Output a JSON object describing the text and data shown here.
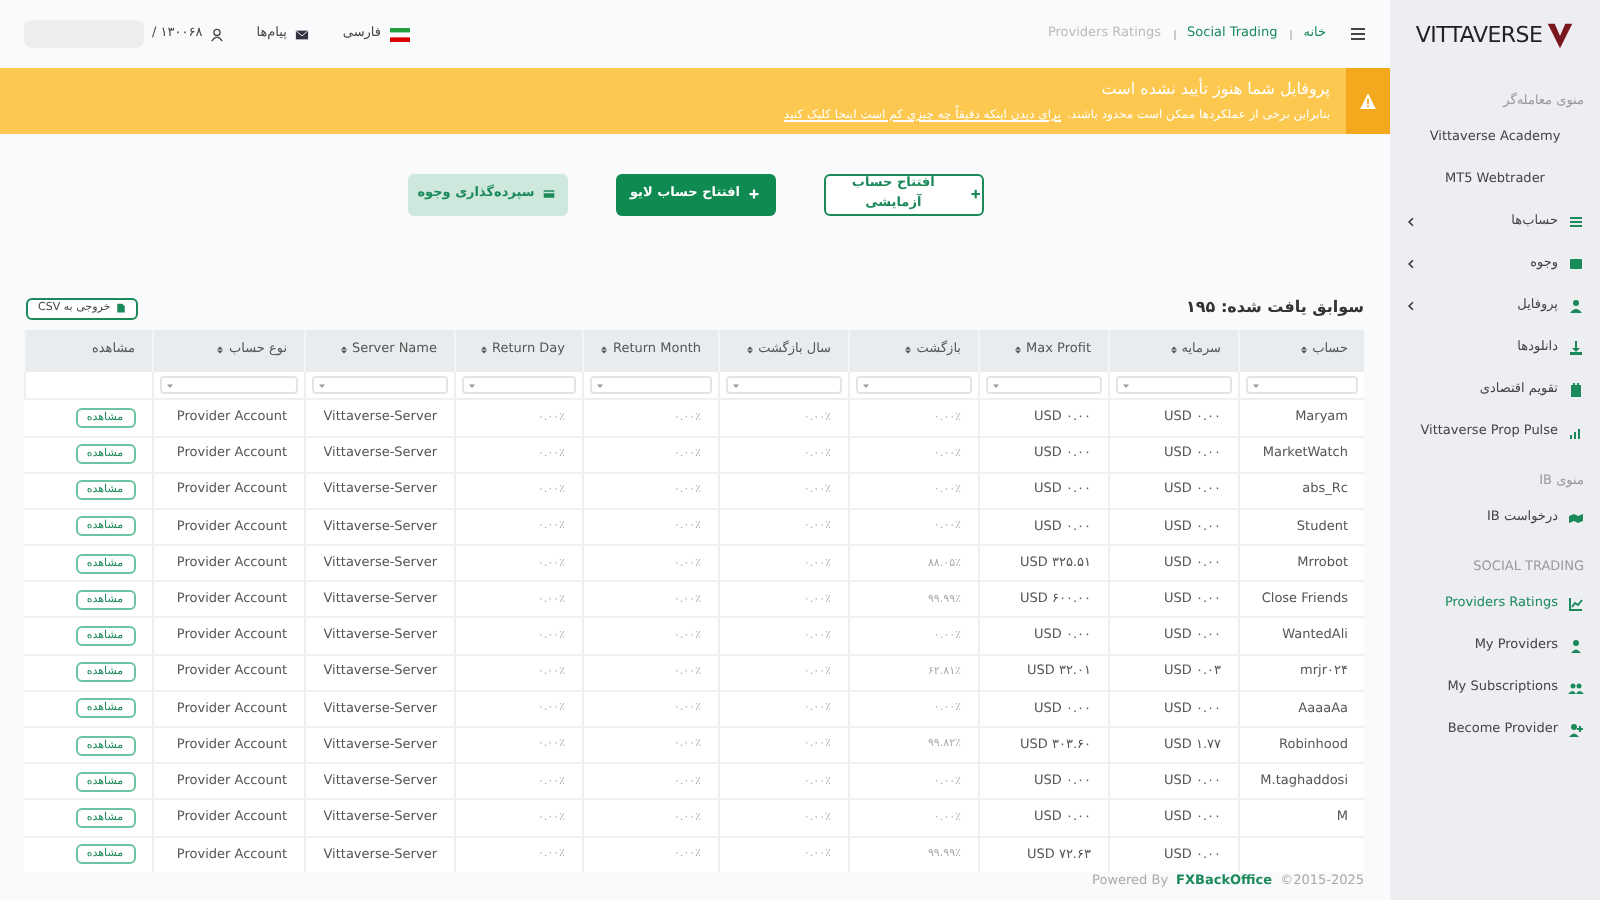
{
  "sidebar": {
    "logo": "VITTAVERSE",
    "items": [
      {
        "kind": "section",
        "label": "منوی معامله‌گر"
      },
      {
        "kind": "link",
        "label": "Vittaverse Academy",
        "expandable": false,
        "selected": false
      },
      {
        "kind": "link",
        "label": "MT5 Webtrader",
        "expandable": false,
        "selected": false
      },
      {
        "kind": "link",
        "label": "حساب‌ها",
        "expandable": true,
        "selected": false
      },
      {
        "kind": "link",
        "label": "وجوه",
        "expandable": true,
        "selected": false
      },
      {
        "kind": "link",
        "label": "پروفایل",
        "expandable": true,
        "selected": false
      },
      {
        "kind": "link",
        "label": "دانلودها",
        "expandable": false,
        "selected": false
      },
      {
        "kind": "link",
        "label": "تقویم اقتصادی",
        "expandable": false,
        "selected": false
      },
      {
        "kind": "link",
        "label": "Vittaverse Prop Pulse",
        "expandable": false,
        "selected": false
      },
      {
        "kind": "section",
        "label": "منوی IB"
      },
      {
        "kind": "link",
        "label": "درخواست IB",
        "expandable": false,
        "selected": false
      },
      {
        "kind": "section",
        "label": "SOCIAL TRADING"
      },
      {
        "kind": "link",
        "label": "Providers Ratings",
        "expandable": false,
        "selected": true
      },
      {
        "kind": "link",
        "label": "My Providers",
        "expandable": false,
        "selected": false
      },
      {
        "kind": "link",
        "label": "My Subscriptions",
        "expandable": false,
        "selected": false
      },
      {
        "kind": "link",
        "label": "Become Provider",
        "expandable": false,
        "selected": false
      }
    ]
  },
  "topbar": {
    "breadcrumbs": [
      {
        "label": "خانه",
        "selected": false
      },
      {
        "label": "Social Trading",
        "selected": false
      },
      {
        "label": "Providers Ratings",
        "selected": true
      }
    ],
    "language": "فارسی",
    "messages": "پیام‌ها",
    "user_id": "۱۳۰۰۶۸ /"
  },
  "banner": {
    "title": "پروفایل شما هنوز تأیید نشده است",
    "text": "بنابراین برخی از عملکردها ممکن است محدود باشند.",
    "link": "برای دیدن اینکه دقیقاً چه چیزی کم است اینجا کلیک کنید"
  },
  "actions": [
    {
      "kind": "outline",
      "label": "افتتاح حساب آزمایشی"
    },
    {
      "kind": "primary",
      "label": "افتتاح حساب لایو"
    },
    {
      "kind": "soft",
      "label": "سپرده‌گذاری وجوه"
    }
  ],
  "records": "سوابق یافت شده: ۱۹۵",
  "export": "خروجی به CSV",
  "table": {
    "columns": [
      {
        "label": "حساب",
        "sortable": true
      },
      {
        "label": "سرمایه",
        "sortable": true
      },
      {
        "label": "Max Profit",
        "sortable": true
      },
      {
        "label": "بازگشت",
        "sortable": true
      },
      {
        "label": "سال بازگشت",
        "sortable": true
      },
      {
        "label": "Return Month",
        "sortable": true
      },
      {
        "label": "Return Day",
        "sortable": true
      },
      {
        "label": "Server Name",
        "sortable": true
      },
      {
        "label": "نوع حساب",
        "sortable": true
      },
      {
        "label": "مشاهده",
        "sortable": false
      }
    ],
    "rows": [
      {
        "cells": [
          "Maryam",
          "USD ۰.۰۰",
          "USD ۰.۰۰",
          "۰.۰۰٪",
          "۰.۰۰٪",
          "۰.۰۰٪",
          "۰.۰۰٪",
          "Vittaverse-Server",
          "Provider Account"
        ],
        "action": "مشاهده"
      },
      {
        "cells": [
          "MarketWatch",
          "USD ۰.۰۰",
          "USD ۰.۰۰",
          "۰.۰۰٪",
          "۰.۰۰٪",
          "۰.۰۰٪",
          "۰.۰۰٪",
          "Vittaverse-Server",
          "Provider Account"
        ],
        "action": "مشاهده"
      },
      {
        "cells": [
          "abs_Rc",
          "USD ۰.۰۰",
          "USD ۰.۰۰",
          "۰.۰۰٪",
          "۰.۰۰٪",
          "۰.۰۰٪",
          "۰.۰۰٪",
          "Vittaverse-Server",
          "Provider Account"
        ],
        "action": "مشاهده"
      },
      {
        "cells": [
          "Student",
          "USD ۰.۰۰",
          "USD ۰.۰۰",
          "۰.۰۰٪",
          "۰.۰۰٪",
          "۰.۰۰٪",
          "۰.۰۰٪",
          "Vittaverse-Server",
          "Provider Account"
        ],
        "action": "مشاهده"
      },
      {
        "cells": [
          "Mrrobot",
          "USD ۰.۰۰",
          "USD ۳۲۵.۵۱",
          "۸۸.۰۵٪",
          "۰.۰۰٪",
          "۰.۰۰٪",
          "۰.۰۰٪",
          "Vittaverse-Server",
          "Provider Account"
        ],
        "action": "مشاهده"
      },
      {
        "cells": [
          "Close Friends",
          "USD ۰.۰۰",
          "USD ۶۰۰.۰۰",
          "۹۹.۹۹٪",
          "۰.۰۰٪",
          "۰.۰۰٪",
          "۰.۰۰٪",
          "Vittaverse-Server",
          "Provider Account"
        ],
        "action": "مشاهده"
      },
      {
        "cells": [
          "WantedAli",
          "USD ۰.۰۰",
          "USD ۰.۰۰",
          "۰.۰۰٪",
          "۰.۰۰٪",
          "۰.۰۰٪",
          "۰.۰۰٪",
          "Vittaverse-Server",
          "Provider Account"
        ],
        "action": "مشاهده"
      },
      {
        "cells": [
          "mrjr۰۲۴",
          "USD ۰.۰۳",
          "USD ۳۲.۰۱",
          "۶۲.۸۱٪",
          "۰.۰۰٪",
          "۰.۰۰٪",
          "۰.۰۰٪",
          "Vittaverse-Server",
          "Provider Account"
        ],
        "action": "مشاهده"
      },
      {
        "cells": [
          "AaaaAa",
          "USD ۰.۰۰",
          "USD ۰.۰۰",
          "۰.۰۰٪",
          "۰.۰۰٪",
          "۰.۰۰٪",
          "۰.۰۰٪",
          "Vittaverse-Server",
          "Provider Account"
        ],
        "action": "مشاهده"
      },
      {
        "cells": [
          "Robinhood",
          "USD ۱.۷۷",
          "USD ۳۰۳.۶۰",
          "۹۹.۸۲٪",
          "۰.۰۰٪",
          "۰.۰۰٪",
          "۰.۰۰٪",
          "Vittaverse-Server",
          "Provider Account"
        ],
        "action": "مشاهده"
      },
      {
        "cells": [
          "M.taghaddosi",
          "USD ۰.۰۰",
          "USD ۰.۰۰",
          "۰.۰۰٪",
          "۰.۰۰٪",
          "۰.۰۰٪",
          "۰.۰۰٪",
          "Vittaverse-Server",
          "Provider Account"
        ],
        "action": "مشاهده"
      },
      {
        "cells": [
          "M",
          "USD ۰.۰۰",
          "USD ۰.۰۰",
          "۰.۰۰٪",
          "۰.۰۰٪",
          "۰.۰۰٪",
          "۰.۰۰٪",
          "Vittaverse-Server",
          "Provider Account"
        ],
        "action": "مشاهده"
      },
      {
        "cells": [
          null,
          "USD ۰.۰۰",
          "USD ۷۲.۶۳",
          "۹۹.۹۹٪",
          "۰.۰۰٪",
          "۰.۰۰٪",
          "۰.۰۰٪",
          "Vittaverse-Server",
          "Provider Account"
        ],
        "action": "مشاهده"
      }
    ]
  },
  "footer": {
    "powered": "Powered By",
    "brand": "FXBackOffice",
    "copyright": "©2015-2025"
  }
}
